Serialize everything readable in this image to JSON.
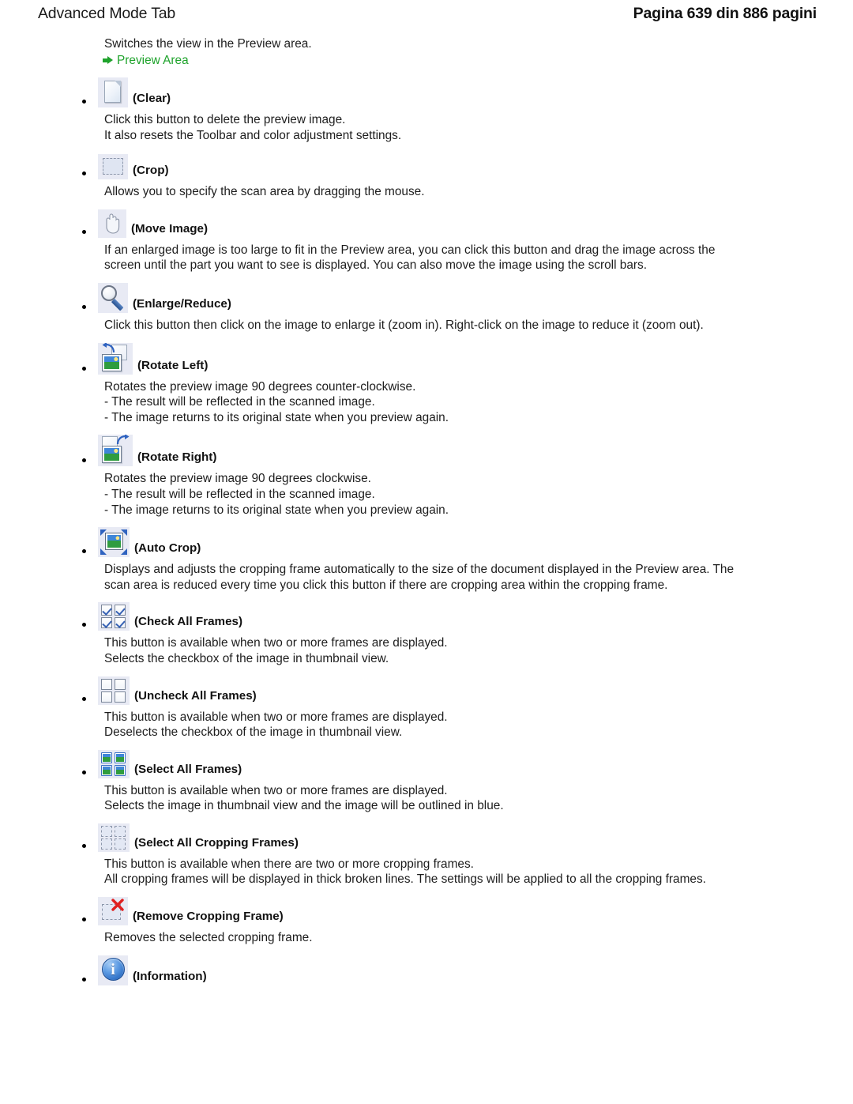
{
  "header": {
    "title": "Advanced Mode Tab",
    "page_info": "Pagina 639 din 886 pagini"
  },
  "intro": {
    "text": "Switches the view in the Preview area.",
    "link_label": "Preview Area",
    "link_color": "#1fa32c"
  },
  "entries": [
    {
      "icon": "clear-page-icon",
      "label": "(Clear)",
      "lines": [
        "Click this button to delete the preview image.",
        "It also resets the Toolbar and color adjustment settings."
      ]
    },
    {
      "icon": "crop-dashed-rectangle-icon",
      "label": "(Crop)",
      "lines": [
        "Allows you to specify the scan area by dragging the mouse."
      ]
    },
    {
      "icon": "move-image-hand-icon",
      "label": "(Move Image)",
      "lines": [
        "If an enlarged image is too large to fit in the Preview area, you can click this button and drag the image across the screen until the part you want to see is displayed. You can also move the image using the scroll bars."
      ]
    },
    {
      "icon": "enlarge-reduce-magnifier-icon",
      "label": "(Enlarge/Reduce)",
      "lines": [
        "Click this button then click on the image to enlarge it (zoom in). Right-click on the image to reduce it (zoom out)."
      ]
    },
    {
      "icon": "rotate-left-icon",
      "label": "(Rotate Left)",
      "lines": [
        "Rotates the preview image 90 degrees counter-clockwise.",
        "- The result will be reflected in the scanned image.",
        "- The image returns to its original state when you preview again."
      ]
    },
    {
      "icon": "rotate-right-icon",
      "label": "(Rotate Right)",
      "lines": [
        "Rotates the preview image 90 degrees clockwise.",
        "- The result will be reflected in the scanned image.",
        "- The image returns to its original state when you preview again."
      ]
    },
    {
      "icon": "auto-crop-icon",
      "label": "(Auto Crop)",
      "lines": [
        "Displays and adjusts the cropping frame automatically to the size of the document displayed in the Preview area. The scan area is reduced every time you click this button if there are cropping area within the cropping frame."
      ]
    },
    {
      "icon": "check-all-frames-icon",
      "label": "(Check All Frames)",
      "lines": [
        "This button is available when two or more frames are displayed.",
        "Selects the checkbox of the image in thumbnail view."
      ]
    },
    {
      "icon": "uncheck-all-frames-icon",
      "label": "(Uncheck All Frames)",
      "lines": [
        "This button is available when two or more frames are displayed.",
        "Deselects the checkbox of the image in thumbnail view."
      ]
    },
    {
      "icon": "select-all-frames-icon",
      "label": "(Select All Frames)",
      "lines": [
        "This button is available when two or more frames are displayed.",
        "Selects the image in thumbnail view and the image will be outlined in blue."
      ]
    },
    {
      "icon": "select-all-cropping-frames-icon",
      "label": "(Select All Cropping Frames)",
      "lines": [
        "This button is available when there are two or more cropping frames.",
        "All cropping frames will be displayed in thick broken lines. The settings will be applied to all the cropping frames."
      ]
    },
    {
      "icon": "remove-cropping-frame-icon",
      "label": "(Remove Cropping Frame)",
      "lines": [
        "Removes the selected cropping frame."
      ]
    },
    {
      "icon": "information-icon",
      "label": "(Information)",
      "lines": []
    }
  ]
}
